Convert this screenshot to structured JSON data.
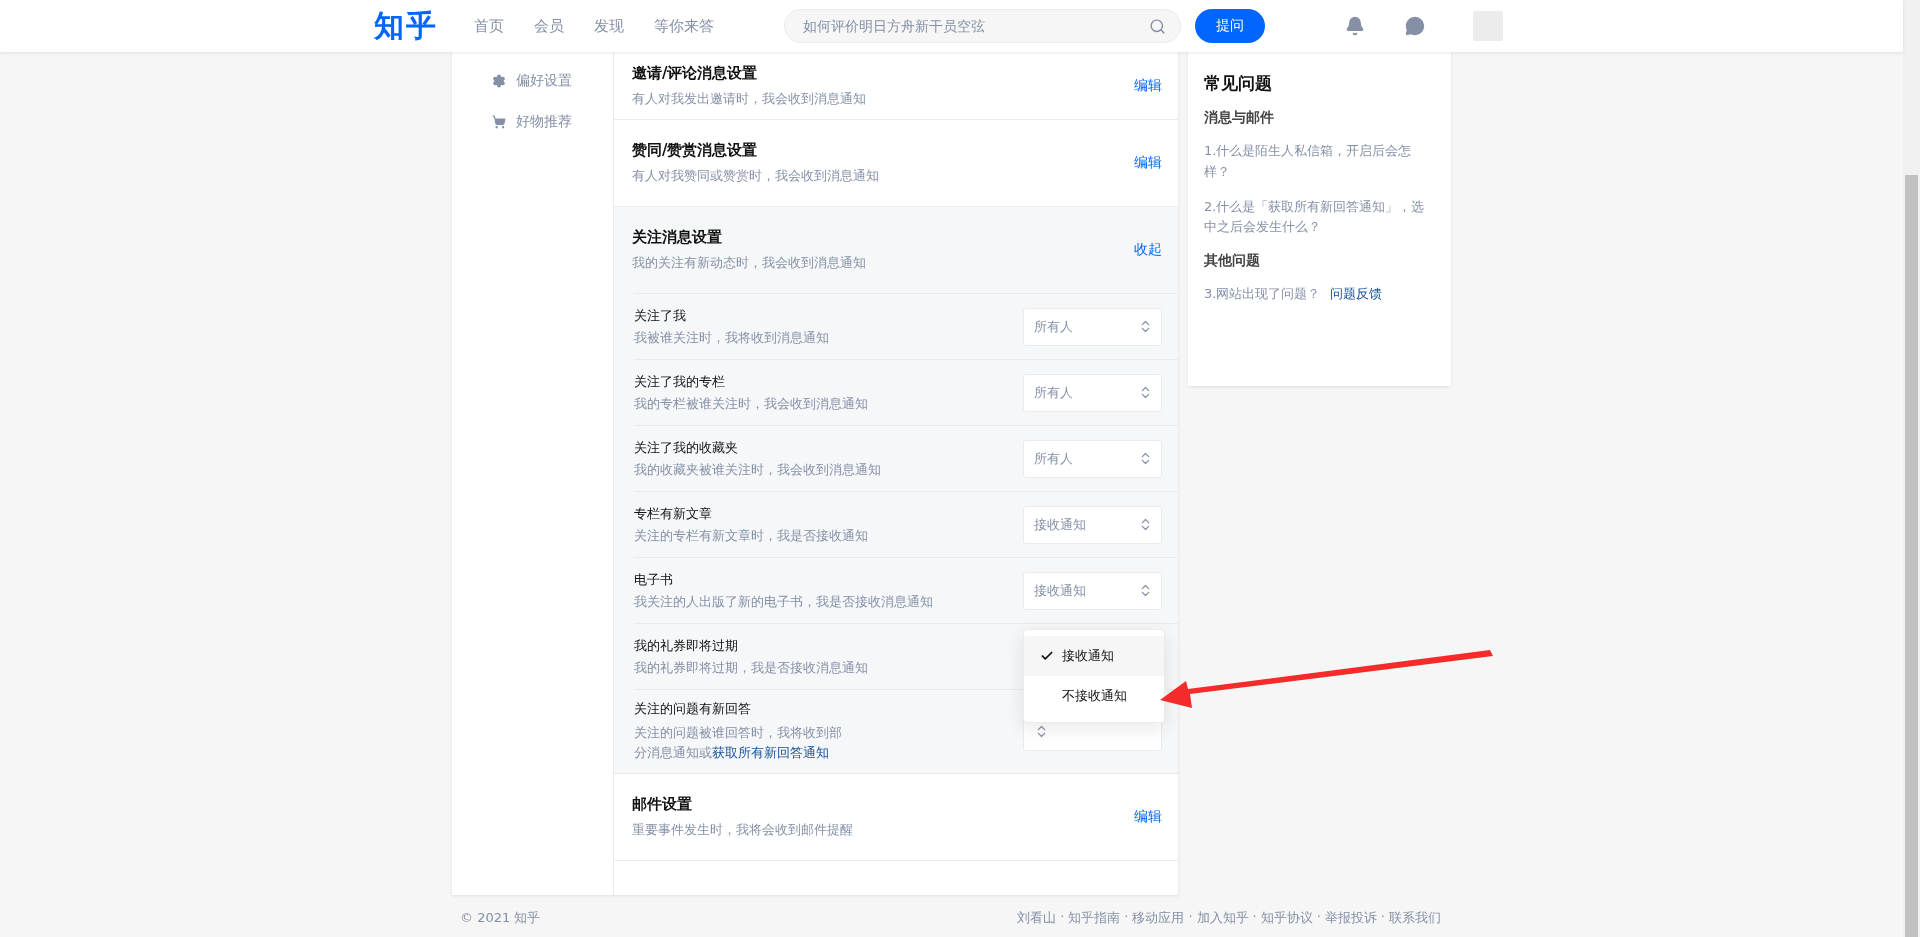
{
  "header": {
    "logo": "知乎",
    "nav": [
      "首页",
      "会员",
      "发现",
      "等你来答"
    ],
    "search": {
      "placeholder": "如何评价明日方舟新干员空弦"
    },
    "ask_button": "提问"
  },
  "sidebar": {
    "items": [
      {
        "label": "偏好设置",
        "kind": "gear"
      },
      {
        "label": "好物推荐",
        "kind": "cart"
      }
    ]
  },
  "sections": [
    {
      "title": "邀请/评论消息设置",
      "description": "有人对我发出邀请时，我会收到消息通知",
      "action": "编辑"
    },
    {
      "title": "赞同/赞赏消息设置",
      "description": "有人对我赞同或赞赏时，我会收到消息通知",
      "action": "编辑"
    },
    {
      "title": "关注消息设置",
      "description": "我的关注有新动态时，我会收到消息通知",
      "action": "收起",
      "rows": [
        {
          "title": "关注了我",
          "description": "我被谁关注时，我将收到消息通知",
          "value": "所有人"
        },
        {
          "title": "关注了我的专栏",
          "description": "我的专栏被谁关注时，我会收到消息通知",
          "value": "所有人"
        },
        {
          "title": "关注了我的收藏夹",
          "description": "我的收藏夹被谁关注时，我会收到消息通知",
          "value": "所有人"
        },
        {
          "title": "专栏有新文章",
          "description": "关注的专栏有新文章时，我是否接收通知",
          "value": "接收通知"
        },
        {
          "title": "电子书",
          "description": "我关注的人出版了新的电子书，我是否接收消息通知",
          "value": "接收通知"
        },
        {
          "title": "我的礼券即将过期",
          "description": "我的礼券即将过期，我是否接收消息通知",
          "dropdown": [
            {
              "label": "接收通知",
              "selected": true
            },
            {
              "label": "不接收通知",
              "selected": false
            }
          ]
        },
        {
          "title": "关注的问题有新回答",
          "description": "关注的问题被谁回答时，我将收到部分消息通知或",
          "link": "获取所有新回答通知"
        }
      ]
    },
    {
      "title": "邮件设置",
      "description": "重要事件发生时，我将会收到邮件提醒",
      "action": "编辑"
    }
  ],
  "faq": {
    "title": "常见问题",
    "groups": [
      {
        "heading": "消息与邮件",
        "items": [
          {
            "text": "1.什么是陌生人私信箱，开启后会怎样？"
          },
          {
            "text": "2.什么是「获取所有新回答通知」，选中之后会发生什么？"
          }
        ]
      },
      {
        "heading": "其他问题",
        "items": [
          {
            "text": "3.网站出现了问题？",
            "link": "问题反馈"
          }
        ]
      }
    ]
  },
  "footer": {
    "copyright": "© 2021 知乎",
    "separator": "·",
    "links": [
      "刘看山",
      "知乎指南",
      "移动应用",
      "加入知乎",
      "知乎协议",
      "举报投诉",
      "联系我们"
    ]
  }
}
